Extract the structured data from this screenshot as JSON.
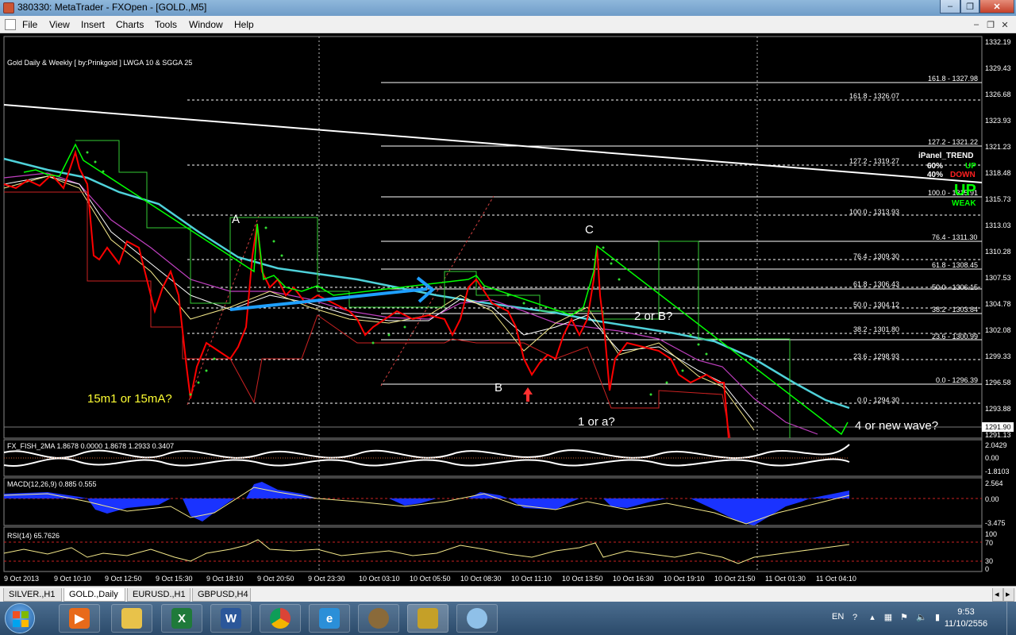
{
  "window": {
    "title": "380330: MetaTrader - FXOpen - [GOLD.,M5]"
  },
  "menu": [
    "File",
    "View",
    "Insert",
    "Charts",
    "Tools",
    "Window",
    "Help"
  ],
  "chart": {
    "indicator_label": "Gold Daily & Weekly [ by:Prinkgold ] LWGA 10 & SGGA 25",
    "price_axis": [
      "1332.19",
      "1329.43",
      "1326.68",
      "1323.93",
      "1321.23",
      "1318.48",
      "1315.73",
      "1313.03",
      "1310.28",
      "1307.53",
      "1304.78",
      "1302.08",
      "1299.33",
      "1296.58",
      "1293.88",
      "1291.13"
    ],
    "current_price": "1291.90",
    "time_axis": [
      "9 Oct 2013",
      "9 Oct 10:10",
      "9 Oct 12:50",
      "9 Oct 15:30",
      "9 Oct 18:10",
      "9 Oct 20:50",
      "9 Oct 23:30",
      "10 Oct 03:10",
      "10 Oct 05:50",
      "10 Oct 08:30",
      "10 Oct 11:10",
      "10 Oct 13:50",
      "10 Oct 16:30",
      "10 Oct 19:10",
      "10 Oct 21:50",
      "11 Oct 01:30",
      "11 Oct 04:10"
    ],
    "fib_levels": [
      {
        "label": "161.8 - 1327.98",
        "set": "right"
      },
      {
        "label": "161.8 - 1326.07",
        "set": "mid"
      },
      {
        "label": "127.2 - 1321.22",
        "set": "right"
      },
      {
        "label": "127.2 - 1319.27",
        "set": "mid"
      },
      {
        "label": "100.0 - 1315.91",
        "set": "right"
      },
      {
        "label": "100.0 - 1313.93",
        "set": "mid"
      },
      {
        "label": "76.4 - 1311.30",
        "set": "right"
      },
      {
        "label": "76.4 - 1309.30",
        "set": "mid"
      },
      {
        "label": "61.8 - 1308.45",
        "set": "right"
      },
      {
        "label": "61.8 - 1306.43",
        "set": "mid"
      },
      {
        "label": "50.0 - 1306.15",
        "set": "right"
      },
      {
        "label": "50.0 - 1304.12",
        "set": "mid"
      },
      {
        "label": "38.2 - 1303.84",
        "set": "right"
      },
      {
        "label": "38.2 - 1301.80",
        "set": "mid"
      },
      {
        "label": "23.6 - 1300.99",
        "set": "right"
      },
      {
        "label": "23.6 - 1298.93",
        "set": "mid"
      },
      {
        "label": "0.0 - 1296.39",
        "set": "right"
      },
      {
        "label": "0.0 - 1294.30",
        "set": "mid"
      }
    ],
    "annotations": {
      "a": "A",
      "b": "B",
      "c": "C",
      "two_or_b": "2 or B?",
      "one_or_a": "1 or a?",
      "fifteen_m": "15m1 or 15mA?",
      "four_or_new": "4 or new wave?"
    },
    "ipanel": {
      "title": "iPanel_TREND",
      "pct_up": "60%",
      "up": "UP",
      "pct_down": "40%",
      "down": "DOWN",
      "big_up": "UP",
      "weak": "WEAK"
    },
    "fisher": {
      "label": "FX_FISH_2MA 1.8678 0.0000 1.8678 1.2933 0.3407",
      "axis": [
        "2.0429",
        "0.00",
        "-1.8103"
      ]
    },
    "macd": {
      "label": "MACD(12,26,9) 0.885 0.555",
      "axis": [
        "2.564",
        "0.00",
        "-3.475"
      ]
    },
    "rsi": {
      "label": "RSI(14) 65.7626",
      "axis": [
        "100",
        "70",
        "30",
        "0"
      ]
    },
    "colors": {
      "bear": "#ff0000",
      "bull": "#00ff00",
      "ma_cyan": "#4fd1d9",
      "ma_magenta": "#c040c0",
      "trend_blue": "#1e9fff",
      "fib": "#ffffff"
    }
  },
  "tabs": [
    {
      "label": "SILVER.,H1",
      "active": false
    },
    {
      "label": "GOLD.,Daily",
      "active": true
    },
    {
      "label": "EURUSD.,H1",
      "active": false
    },
    {
      "label": "GBPUSD,H4",
      "active": false
    }
  ],
  "taskbar": {
    "apps": [
      "media-player-icon",
      "folder-icon",
      "excel-icon",
      "word-icon",
      "chrome-icon",
      "ie-icon",
      "app-lion-icon",
      "metatrader-icon",
      "paint-icon"
    ],
    "lang": "EN",
    "time": "9:53",
    "date": "11/10/2556"
  }
}
